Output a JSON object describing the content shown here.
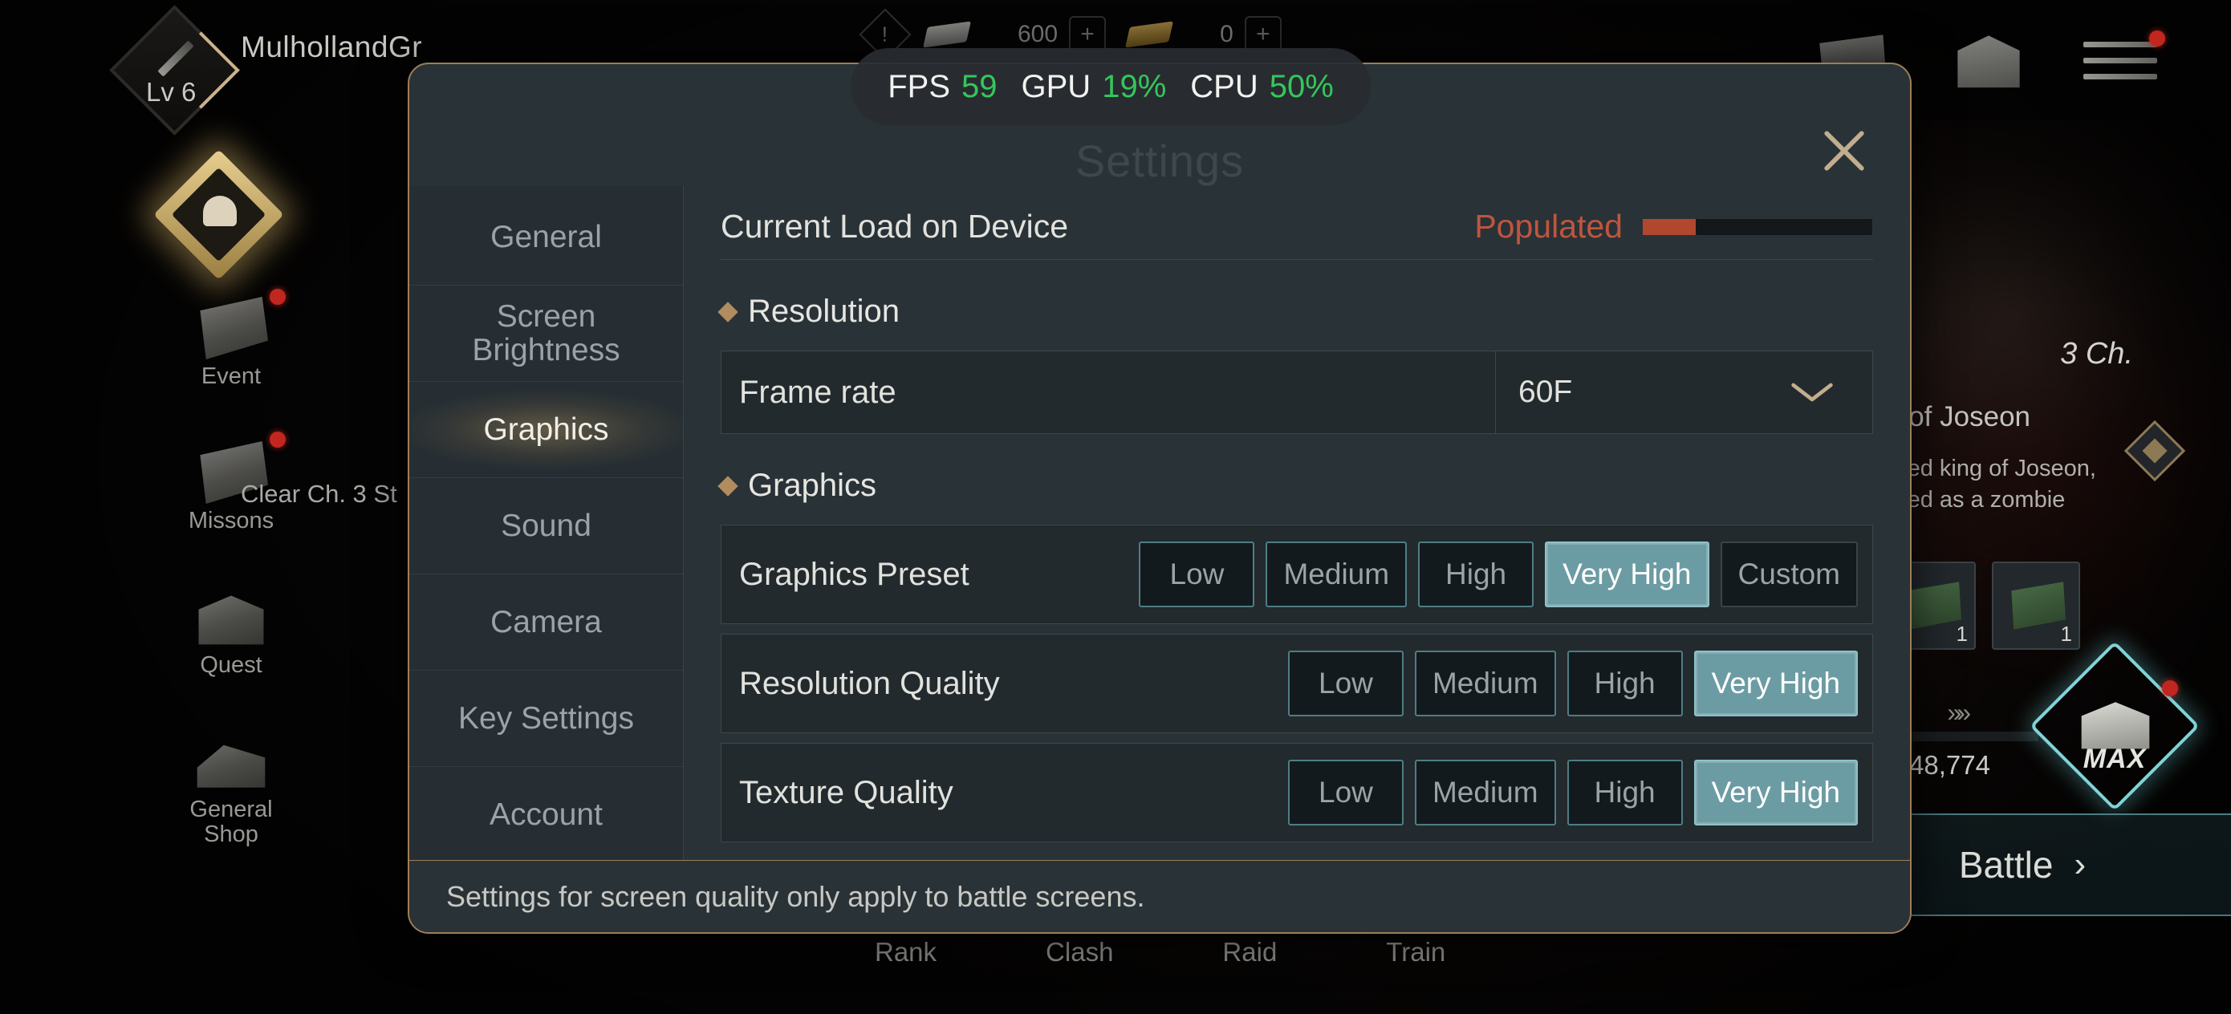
{
  "fps_overlay": {
    "fps_label": "FPS",
    "fps_value": "59",
    "gpu_label": "GPU",
    "gpu_value": "19%",
    "cpu_label": "CPU",
    "cpu_value": "50%",
    "value_color": "#35c759"
  },
  "game_hud": {
    "player_name": "MulhollandGr",
    "player_level": "Lv 6",
    "currency": [
      {
        "icon": "silver-ingot-icon",
        "value": "600",
        "add": "+"
      },
      {
        "icon": "gold-ingot-icon",
        "value": "0",
        "add": "+"
      }
    ],
    "alert_glyph": "!",
    "left_menu": [
      {
        "icon": "event-calendar-icon",
        "label": "Event",
        "badge": true
      },
      {
        "icon": "missions-scroll-icon",
        "label": "Missons",
        "badge": true
      },
      {
        "icon": "quest-chest-icon",
        "label": "Quest",
        "badge": false
      },
      {
        "icon": "general-shop-icon",
        "label": "General\nShop",
        "badge": false
      }
    ],
    "quest_banner": "Clear Ch. 3 St",
    "character": {
      "chapter": "3 Ch.",
      "title": "of Joseon",
      "desc_line1": "ed king of Joseon,",
      "desc_line2": "ed as a zombie"
    },
    "items": [
      {
        "icon": "green-book-icon",
        "qty": "1"
      },
      {
        "icon": "green-book-icon",
        "qty": "1"
      }
    ],
    "exp_value": "48,774",
    "exp_chevrons": "»»",
    "chest_max_label": "MAX",
    "battle_label": "Battle",
    "battle_chevron": "›",
    "bottom_nav": [
      "Rank",
      "Clash",
      "Raid",
      "Train"
    ]
  },
  "modal": {
    "title": "Settings",
    "close_icon": "close-icon",
    "sidebar": [
      {
        "label": "General",
        "active": false
      },
      {
        "label": "Screen\nBrightness",
        "active": false
      },
      {
        "label": "Graphics",
        "active": true
      },
      {
        "label": "Sound",
        "active": false
      },
      {
        "label": "Camera",
        "active": false
      },
      {
        "label": "Key Settings",
        "active": false
      },
      {
        "label": "Account",
        "active": false
      }
    ],
    "device_load": {
      "label": "Current Load on Device",
      "status": "Populated",
      "status_color": "#c0553d",
      "fill_percent": 23,
      "fill_color": "#b2472f"
    },
    "sections": [
      {
        "title": "Resolution",
        "dropdowns": [
          {
            "label": "Frame rate",
            "value": "60F",
            "icon": "chevron-down-icon"
          }
        ]
      },
      {
        "title": "Graphics",
        "button_rows": [
          {
            "label": "Graphics Preset",
            "options": [
              "Low",
              "Medium",
              "High",
              "Very High",
              "Custom"
            ],
            "selected": "Very High",
            "plain": [
              "Custom"
            ]
          },
          {
            "label": "Resolution Quality",
            "options": [
              "Low",
              "Medium",
              "High",
              "Very High"
            ],
            "selected": "Very High",
            "plain": []
          },
          {
            "label": "Texture Quality",
            "options": [
              "Low",
              "Medium",
              "High",
              "Very High"
            ],
            "selected": "Very High",
            "plain": []
          }
        ]
      }
    ],
    "footer_note": "Settings for screen quality only apply to battle screens.",
    "accent_border": "#9d7e57",
    "selected_color": "#6c9ca3"
  }
}
